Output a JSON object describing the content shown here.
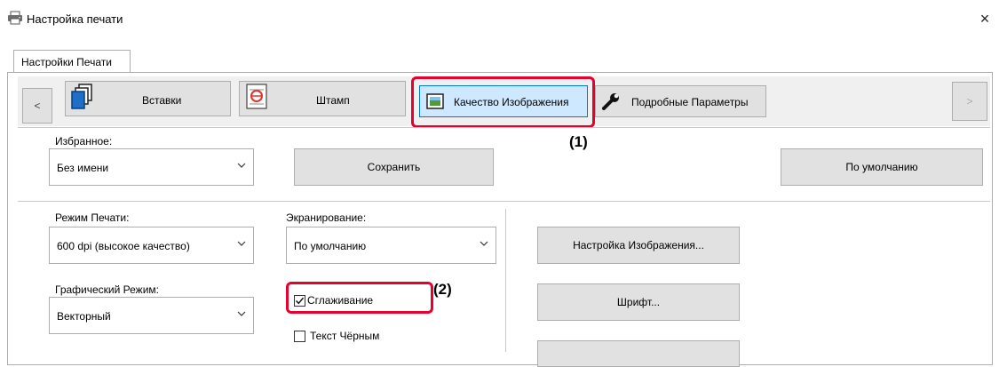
{
  "window": {
    "title": "Настройка печати",
    "close_glyph": "×"
  },
  "tabs": [
    {
      "label": "Настройки Печати"
    }
  ],
  "sheet_tabs": {
    "prev_glyph": "<",
    "next_glyph": ">",
    "items": [
      {
        "label": "Вставки",
        "icon": "pages-stack-icon"
      },
      {
        "label": "Штамп",
        "icon": "stamp-icon"
      },
      {
        "label": "Качество Изображения",
        "icon": "image-quality-icon"
      },
      {
        "label": "Подробные Параметры",
        "icon": "wrench-icon"
      }
    ]
  },
  "callouts": {
    "one": "(1)",
    "two": "(2)"
  },
  "favorites": {
    "label": "Избранное:",
    "value": "Без имени",
    "save_label": "Сохранить",
    "default_label": "По умолчанию"
  },
  "print_mode": {
    "label": "Режим Печати:",
    "value": "600 dpi (высокое качество)"
  },
  "screening": {
    "label": "Экранирование:",
    "value": "По умолчанию"
  },
  "graphics_mode": {
    "label": "Графический Режим:",
    "value": "Векторный"
  },
  "smoothing": {
    "label": "Сглаживание",
    "checked": true
  },
  "text_black": {
    "label": "Текст Чёрным",
    "checked": false
  },
  "right_buttons": {
    "image_settings": "Настройка Изображения...",
    "font": "Шрифт..."
  },
  "colors": {
    "highlight_red": "#e6002d",
    "selected_tab_blue": "#cde8ff"
  }
}
